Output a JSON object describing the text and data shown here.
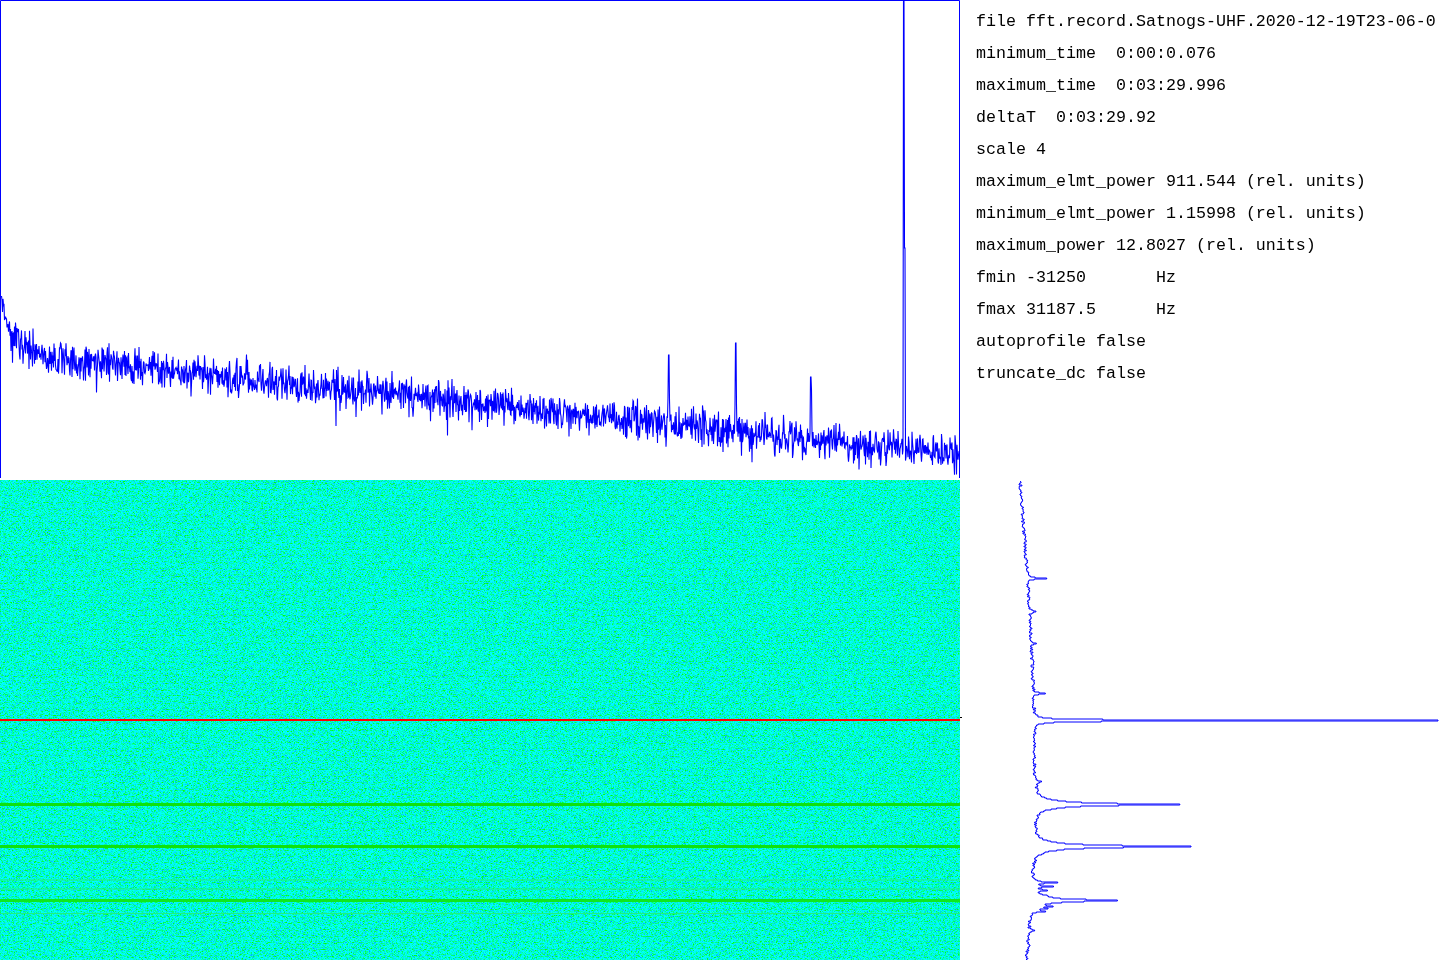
{
  "info_panel": {
    "lines": [
      "file fft.record.Satnogs-UHF.2020-12-19T23-06-0",
      "minimum_time  0:00:0.076",
      "maximum_time  0:03:29.996",
      "deltaT  0:03:29.92",
      "scale 4",
      "maximum_elmt_power 911.544 (rel. units)",
      "minimum_elmt_power 1.15998 (rel. units)",
      "maximum_power 12.8027 (rel. units)",
      "fmin -31250       Hz",
      "fmax 31187.5      Hz",
      "autoprofile false",
      "truncate_dc false"
    ]
  }
}
